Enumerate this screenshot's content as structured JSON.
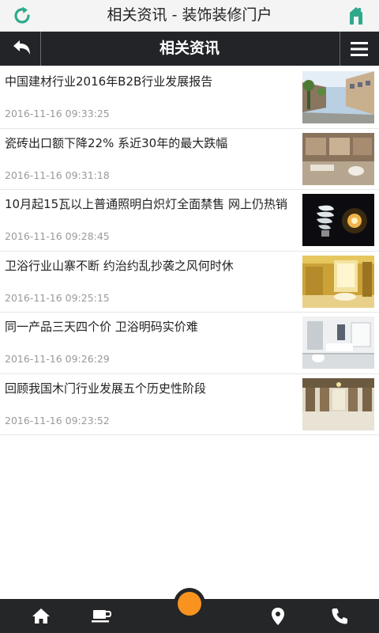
{
  "app": {
    "title": "相关资讯 - 装饰装修门户"
  },
  "nav": {
    "title": "相关资讯"
  },
  "articles": [
    {
      "title": "中国建材行业2016年B2B行业发展报告",
      "date": "2016-11-16 09:33:25",
      "thumb": "street-scene"
    },
    {
      "title": "瓷砖出口额下降22% 系近30年的最大跌幅",
      "date": "2016-11-16 09:31:18",
      "thumb": "bathroom-tiles"
    },
    {
      "title": "10月起15瓦以上普通照明白炽灯全面禁售 网上仍热销",
      "date": "2016-11-16 09:28:45",
      "thumb": "light-bulbs"
    },
    {
      "title": "卫浴行业山寨不断 约治约乱抄袭之风何时休",
      "date": "2016-11-16 09:25:15",
      "thumb": "yellow-bathroom"
    },
    {
      "title": "同一产品三天四个价 卫浴明码实价难",
      "date": "2016-11-16 09:26:29",
      "thumb": "white-bathroom"
    },
    {
      "title": "回顾我国木门行业发展五个历史性阶段",
      "date": "2016-11-16 09:23:52",
      "thumb": "door-hall"
    }
  ],
  "tabbar": {
    "items": [
      "home-icon",
      "coffee-icon",
      "location-icon",
      "phone-icon"
    ],
    "center_color": "#f7931e"
  },
  "colors": {
    "accent": "#2eaa8a",
    "nav_bg": "#222428"
  }
}
